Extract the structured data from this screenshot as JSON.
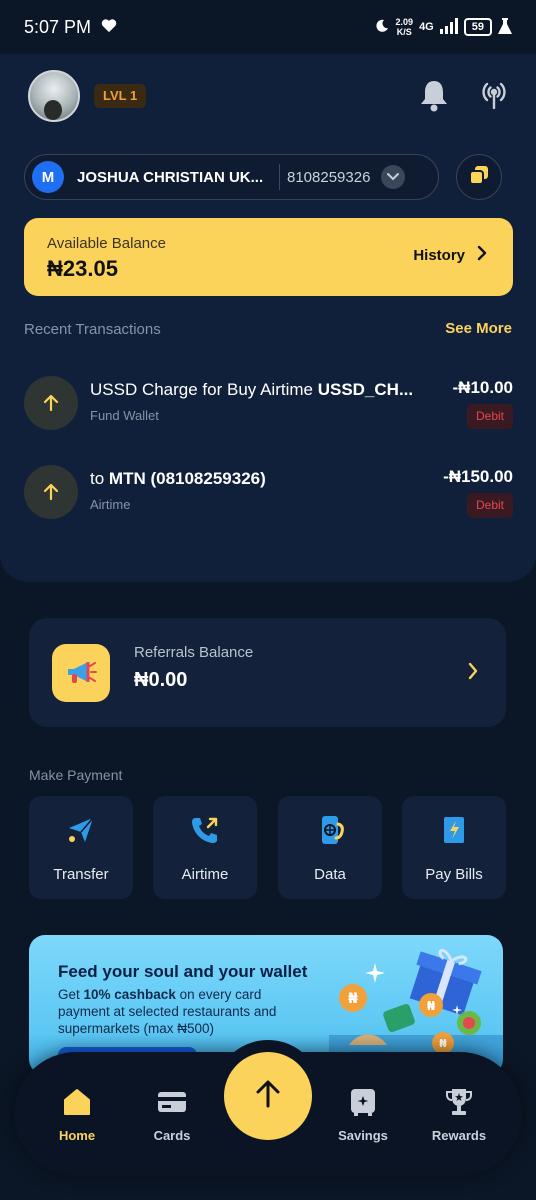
{
  "status_bar": {
    "time": "5:07 PM",
    "net_speed_value": "2.09",
    "net_speed_unit": "K/S",
    "network": "4G",
    "battery": "59"
  },
  "header": {
    "level_badge": "LVL 1"
  },
  "account": {
    "initial": "M",
    "name": "JOSHUA CHRISTIAN UK...",
    "number": "8108259326"
  },
  "balance": {
    "label": "Available Balance",
    "value": "₦23.05",
    "history_label": "History"
  },
  "recent": {
    "title": "Recent Transactions",
    "see_more": "See More",
    "transactions": [
      {
        "title_plain": "USSD Charge for Buy Airtime ",
        "title_bold": "USSD_CH...",
        "subtitle": "Fund Wallet",
        "amount": "-₦10.00",
        "badge": "Debit"
      },
      {
        "title_plain": "to ",
        "title_bold": "MTN (08108259326)",
        "subtitle": "Airtime",
        "amount": "-₦150.00",
        "badge": "Debit"
      }
    ]
  },
  "referrals": {
    "label": "Referrals Balance",
    "value": "₦0.00"
  },
  "make_payment": {
    "title": "Make Payment",
    "items": [
      {
        "label": "Transfer"
      },
      {
        "label": "Airtime"
      },
      {
        "label": "Data"
      },
      {
        "label": "Pay Bills"
      }
    ]
  },
  "promo": {
    "title": "Feed your soul and your wallet",
    "text_pre": "Get ",
    "text_bold": "10% cashback",
    "text_post": " on every card payment at selected restaurants and supermarkets (max ₦500)"
  },
  "nav": {
    "items": [
      {
        "label": "Home"
      },
      {
        "label": "Cards"
      },
      {
        "label": "Savings"
      },
      {
        "label": "Rewards"
      }
    ]
  },
  "colors": {
    "accent": "#fcd35a",
    "background": "#0b1626",
    "card": "#13223a",
    "debit": "#e5484d"
  }
}
